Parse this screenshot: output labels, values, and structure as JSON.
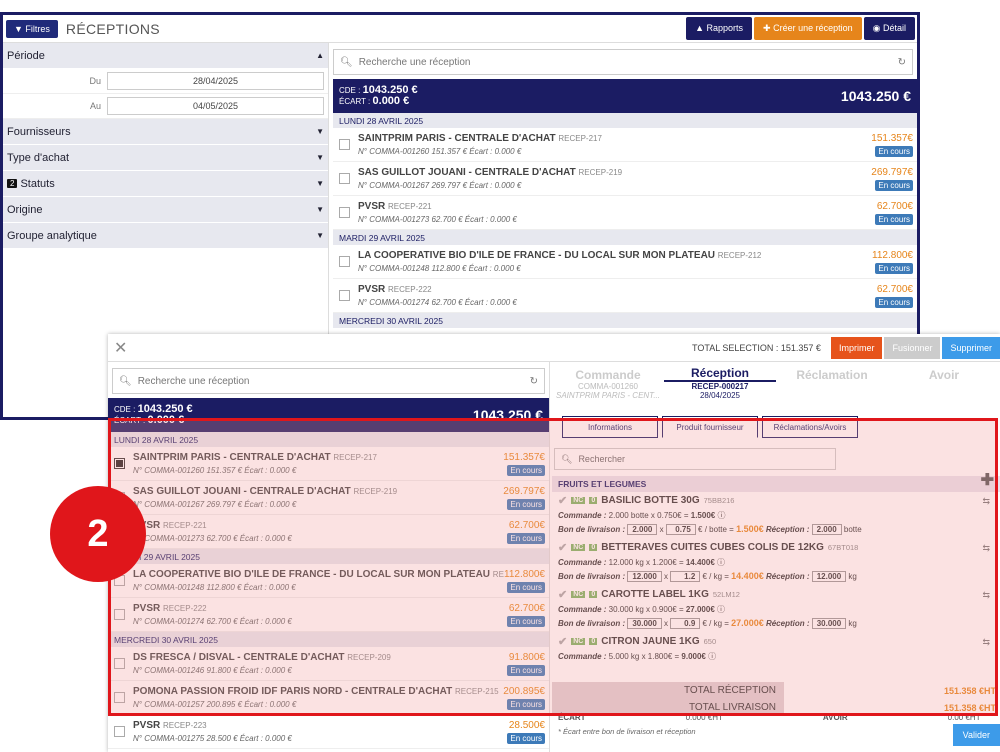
{
  "win1": {
    "filters_btn": "Filtres",
    "title": "RÉCEPTIONS",
    "rapports": "Rapports",
    "creer": "Créer une réception",
    "detail": "Détail",
    "filters": {
      "periode": "Période",
      "du_label": "Du",
      "du_value": "28/04/2025",
      "au_label": "Au",
      "au_value": "04/05/2025",
      "fournisseurs": "Fournisseurs",
      "type_achat": "Type d'achat",
      "statuts_count": "2",
      "statuts": "Statuts",
      "origine": "Origine",
      "groupe": "Groupe analytique"
    },
    "search_placeholder": "Recherche une réception",
    "cde_label": "CDE :",
    "cde_value": "1043.250 €",
    "ecart_label": "ÉCART :",
    "ecart_value": "0.000 €",
    "total": "1043.250 €",
    "days": [
      {
        "label": "LUNDI 28 AVRIL 2025",
        "items": [
          {
            "name": "SAINTPRIM PARIS - CENTRALE D'ACHAT",
            "ref": "RECEP-217",
            "sub": "N° COMMA-001260  151.357 €  Écart : 0.000 €",
            "amount": "151.357€",
            "status": "En cours"
          },
          {
            "name": "SAS GUILLOT JOUANI - CENTRALE D'ACHAT",
            "ref": "RECEP-219",
            "sub": "N° COMMA-001267  269.797 €  Écart : 0.000 €",
            "amount": "269.797€",
            "status": "En cours"
          },
          {
            "name": "PVSR",
            "ref": "RECEP-221",
            "sub": "N° COMMA-001273  62.700 €  Écart : 0.000 €",
            "amount": "62.700€",
            "status": "En cours"
          }
        ]
      },
      {
        "label": "MARDI 29 AVRIL 2025",
        "items": [
          {
            "name": "LA COOPERATIVE BIO D'ILE DE FRANCE - DU LOCAL SUR MON PLATEAU",
            "ref": "RECEP-212",
            "sub": "N° COMMA-001248  112.800 €  Écart : 0.000 €",
            "amount": "112.800€",
            "status": "En cours"
          },
          {
            "name": "PVSR",
            "ref": "RECEP-222",
            "sub": "N° COMMA-001274  62.700 €  Écart : 0.000 €",
            "amount": "62.700€",
            "status": "En cours"
          }
        ]
      },
      {
        "label": "MERCREDI 30 AVRIL 2025",
        "items": [
          {
            "name": "DS FRESCA / DISVAL - CENTRALE D'ACHAT",
            "ref": "RECEP-209",
            "sub": "",
            "amount": "91.800€",
            "status": ""
          }
        ]
      }
    ]
  },
  "win2": {
    "total_selection": "TOTAL SELECTION : 151.357 €",
    "imprimer": "Imprimer",
    "fusionner": "Fusionner",
    "supprimer": "Supprimer",
    "search_placeholder": "Recherche une réception",
    "cde_label": "CDE :",
    "cde_value": "1043.250 €",
    "ecart_label": "ÉCART :",
    "ecart_value": "0.000 €",
    "total": "1043.250 €",
    "list": [
      {
        "day": "LUNDI 28 AVRIL 2025"
      },
      {
        "name": "SAINTPRIM PARIS - CENTRALE D'ACHAT",
        "ref": "RECEP-217",
        "sub": "N° COMMA-001260  151.357 €  Écart : 0.000 €",
        "amount": "151.357€",
        "status": "En cours",
        "checked": true
      },
      {
        "name": "SAS GUILLOT JOUANI - CENTRALE D'ACHAT",
        "ref": "RECEP-219",
        "sub": "N° COMMA-001267  269.797 €  Écart : 0.000 €",
        "amount": "269.797€",
        "status": "En cours"
      },
      {
        "name": "PVSR",
        "ref": "RECEP-221",
        "sub": "N° COMMA-001273  62.700 €  Écart : 0.000 €",
        "amount": "62.700€",
        "status": "En cours"
      },
      {
        "day": "MARDI 29 AVRIL 2025"
      },
      {
        "name": "LA COOPERATIVE BIO D'ILE DE FRANCE - DU LOCAL SUR MON PLATEAU",
        "ref": "RECEP-212",
        "sub": "N° COMMA-001248  112.800 €  Écart : 0.000 €",
        "amount": "112.800€",
        "status": "En cours"
      },
      {
        "name": "PVSR",
        "ref": "RECEP-222",
        "sub": "N° COMMA-001274  62.700 €  Écart : 0.000 €",
        "amount": "62.700€",
        "status": "En cours"
      },
      {
        "day": "MERCREDI 30 AVRIL 2025"
      },
      {
        "name": "DS FRESCA / DISVAL - CENTRALE D'ACHAT",
        "ref": "RECEP-209",
        "sub": "N° COMMA-001246  91.800 €  Écart : 0.000 €",
        "amount": "91.800€",
        "status": "En cours"
      },
      {
        "name": "POMONA PASSION FROID IDF PARIS NORD - CENTRALE D'ACHAT",
        "ref": "RECEP-215",
        "sub": "N° COMMA-001257  200.895 €  Écart : 0.000 €",
        "amount": "200.895€",
        "status": "En cours"
      },
      {
        "name": "PVSR",
        "ref": "RECEP-223",
        "sub": "N° COMMA-001275  28.500 €  Écart : 0.000 €",
        "amount": "28.500€",
        "status": "En cours"
      }
    ],
    "tabs": [
      "Commande",
      "Réception",
      "Réclamation",
      "Avoir"
    ],
    "tab_sub_left": [
      "COMMA-001260",
      "SAINTPRIM PARIS - CENT..."
    ],
    "tab_sub_center": [
      "RECEP-000217",
      "28/04/2025"
    ],
    "subtabs": [
      "Informations",
      "Produit fournisseur",
      "Réclamations/Avoirs"
    ],
    "search2": "Rechercher",
    "category": "FRUITS ET LEGUMES",
    "products": [
      {
        "nc": "NC",
        "zero": "0",
        "name": "BASILIC BOTTE 30G",
        "code": "75BB216",
        "cmd_label": "Commande :",
        "cmd": "2.000 botte x 0.750€ =",
        "cmd_total": "1.500€",
        "bl_label": "Bon de livraison :",
        "bl_qty": "2.000",
        "bl_price": "0.75",
        "bl_unit": "€ / botte =",
        "bl_total": "1.500€",
        "rec_label": "Réception :",
        "rec_qty": "2.000",
        "rec_unit": "botte"
      },
      {
        "nc": "NC",
        "zero": "0",
        "name": "BETTERAVES CUITES CUBES COLIS DE 12KG",
        "code": "67BT018",
        "cmd_label": "Commande :",
        "cmd": "12.000 kg x 1.200€ =",
        "cmd_total": "14.400€",
        "bl_label": "Bon de livraison :",
        "bl_qty": "12.000",
        "bl_price": "1.2",
        "bl_unit": "€ / kg =",
        "bl_total": "14.400€",
        "rec_label": "Réception :",
        "rec_qty": "12.000",
        "rec_unit": "kg"
      },
      {
        "nc": "NC",
        "zero": "0",
        "name": "CAROTTE LABEL 1KG",
        "code": "52LM12",
        "cmd_label": "Commande :",
        "cmd": "30.000 kg x 0.900€ =",
        "cmd_total": "27.000€",
        "bl_label": "Bon de livraison :",
        "bl_qty": "30.000",
        "bl_price": "0.9",
        "bl_unit": "€ / kg =",
        "bl_total": "27.000€",
        "rec_label": "Réception :",
        "rec_qty": "30.000",
        "rec_unit": "kg"
      },
      {
        "nc": "NC",
        "zero": "0",
        "name": "CITRON JAUNE 1KG",
        "code": "650",
        "cmd_label": "Commande :",
        "cmd": "5.000 kg x 1.800€ =",
        "cmd_total": "9.000€",
        "bl_label": "",
        "bl_qty": "",
        "bl_price": "",
        "bl_unit": "",
        "bl_total": "",
        "rec_label": "",
        "rec_qty": "",
        "rec_unit": ""
      }
    ],
    "total_reception_label": "TOTAL RÉCEPTION",
    "total_reception_value": "151.358 €HT",
    "total_livraison_label": "TOTAL LIVRAISON",
    "total_livraison_value": "151.358 €HT",
    "ecart_label2": "ÉCART",
    "ecart_value2": "0.000 €HT",
    "avoir_label": "AVOIR",
    "avoir_value": "0.00 €HT",
    "note": "* Écart entre bon de livraison et réception",
    "valider": "Valider"
  },
  "callout": "2",
  "colors": {
    "navy": "#1b1c63",
    "orange": "#e6851b",
    "blue": "#3d7ab8",
    "red": "#e0161b"
  }
}
